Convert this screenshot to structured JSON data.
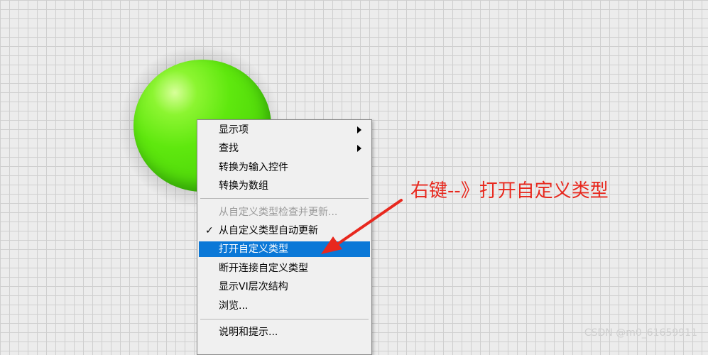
{
  "context_menu": {
    "items": [
      {
        "label": "显示项",
        "submenu": true
      },
      {
        "label": "查找",
        "submenu": true
      },
      {
        "label": "转换为输入控件"
      },
      {
        "label": "转换为数组"
      },
      {
        "label": "从自定义类型检查并更新...",
        "disabled": true
      },
      {
        "label": "从自定义类型自动更新",
        "checked": true,
        "check_mark": "✓"
      },
      {
        "label": "打开自定义类型",
        "selected": true
      },
      {
        "label": "断开连接自定义类型"
      },
      {
        "label": "显示VI层次结构"
      },
      {
        "label": "浏览..."
      },
      {
        "label": "说明和提示..."
      }
    ]
  },
  "annotation": {
    "text": "右键--》打开自定义类型",
    "color": "#e8281e"
  },
  "watermark": "CSDN @m0_61659911",
  "colors": {
    "led_green": "#5fe80e",
    "selection_blue": "#0a78d7"
  }
}
